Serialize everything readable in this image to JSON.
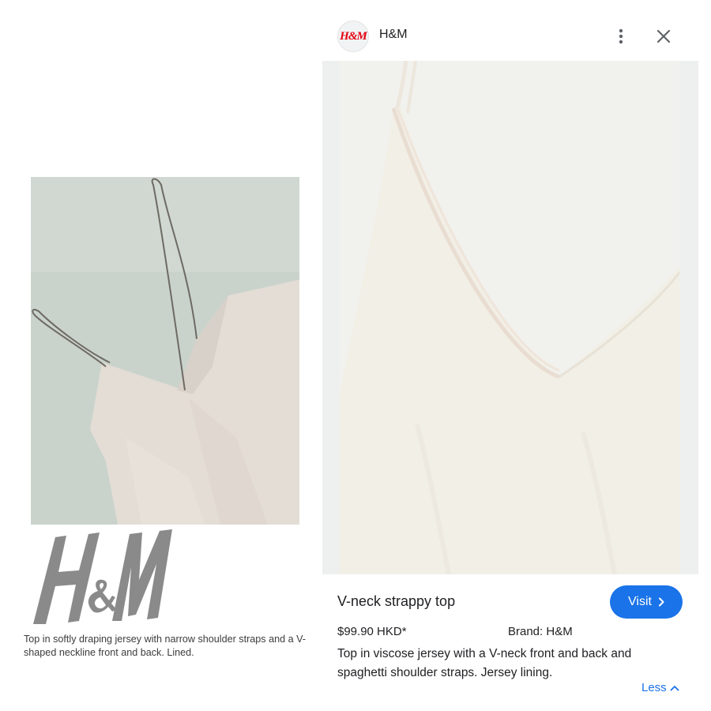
{
  "collage": {
    "logo_text": "H&M",
    "description": "Top in softly draping jersey with narrow shoulder straps and a V-shaped neckline front and back. Lined."
  },
  "card": {
    "brand_avatar_text": "H&M",
    "brand_name": "H&M",
    "product_title": "V-neck strappy top",
    "visit_label": "Visit",
    "price": "$99.90 HKD*",
    "brand_line": "Brand: H&M",
    "description": "Top in viscose jersey with a V-neck front and back and spaghetti shoulder straps. Jersey lining.",
    "less_label": "Less"
  },
  "colors": {
    "accent": "#1a73e8",
    "brand_red": "#e50010",
    "logo_gray": "#8a8a8a"
  },
  "icons": {
    "more": "more-vertical-icon",
    "close": "close-icon",
    "visit_chevron": "chevron-right-icon",
    "less_chevron": "chevron-up-icon"
  }
}
